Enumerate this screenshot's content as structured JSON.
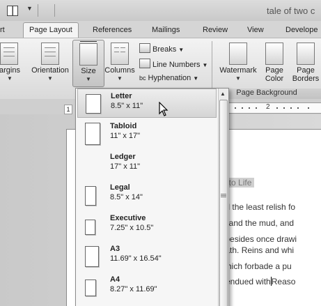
{
  "window": {
    "title": "tale of two c"
  },
  "tabs": [
    {
      "label": "rt"
    },
    {
      "label": "Page Layout"
    },
    {
      "label": "References"
    },
    {
      "label": "Mailings"
    },
    {
      "label": "Review"
    },
    {
      "label": "View"
    },
    {
      "label": "Develope"
    }
  ],
  "ribbon": {
    "margins": "argins",
    "orientation": "Orientation",
    "size": "Size",
    "columns": "Columns",
    "breaks": "Breaks",
    "line_numbers": "Line Numbers",
    "hyphenation": "Hyphenation",
    "hyphenation_icon_text": "bc",
    "watermark": "Watermark",
    "page_color_line1": "Page",
    "page_color_line2": "Color",
    "page_borders_line1": "Page",
    "page_borders_line2": "Borders",
    "group_label": "Page Background",
    "ruler_one": "1",
    "ruler_two": "2"
  },
  "size_menu": {
    "items": [
      {
        "name": "Letter",
        "dims": "8.5\" x 11\"",
        "selected": true
      },
      {
        "name": "Tabloid",
        "dims": "11\" x 17\""
      },
      {
        "name": "Ledger",
        "dims": "17\" x 11\""
      },
      {
        "name": "Legal",
        "dims": "8.5\" x 14\""
      },
      {
        "name": "Executive",
        "dims": "7.25\" x 10.5\""
      },
      {
        "name": "A3",
        "dims": "11.69\" x 16.54\""
      },
      {
        "name": "A4",
        "dims": "8.27\" x 11.69\""
      }
    ]
  },
  "document": {
    "heading": "ed to Life",
    "lines": [
      "had the least relish fo",
      "ss, and the mud, and",
      "p, besides once drawi",
      "heath.  Reins and whi",
      "r which forbade a pu",
      "re endued with",
      "Reaso"
    ]
  },
  "colors": {
    "hover": "#dcdcdc",
    "heading_highlight": "#cfcfcf"
  }
}
